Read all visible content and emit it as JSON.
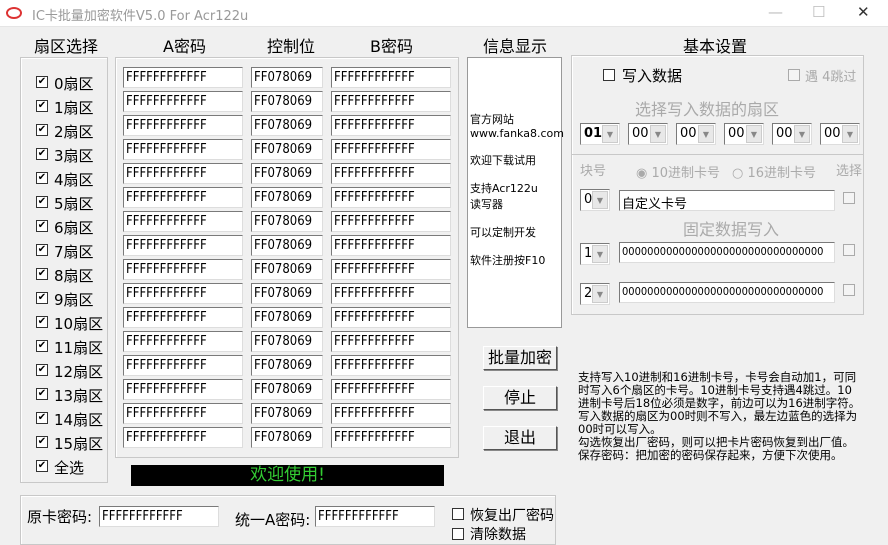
{
  "window": {
    "title": "IC卡批量加密软件V5.0 For Acr122u",
    "min": "—",
    "max": "☐",
    "close": "✕"
  },
  "headers": {
    "sector": "扇区选择",
    "a_key": "A密码",
    "control": "控制位",
    "b_key": "B密码",
    "info": "信息显示",
    "settings": "基本设置"
  },
  "sectors": [
    {
      "label": "0扇区",
      "checked": true,
      "a": "FFFFFFFFFFFF",
      "ctrl": "FF078069",
      "b": "FFFFFFFFFFFF"
    },
    {
      "label": "1扇区",
      "checked": true,
      "a": "FFFFFFFFFFFF",
      "ctrl": "FF078069",
      "b": "FFFFFFFFFFFF"
    },
    {
      "label": "2扇区",
      "checked": true,
      "a": "FFFFFFFFFFFF",
      "ctrl": "FF078069",
      "b": "FFFFFFFFFFFF"
    },
    {
      "label": "3扇区",
      "checked": true,
      "a": "FFFFFFFFFFFF",
      "ctrl": "FF078069",
      "b": "FFFFFFFFFFFF"
    },
    {
      "label": "4扇区",
      "checked": true,
      "a": "FFFFFFFFFFFF",
      "ctrl": "FF078069",
      "b": "FFFFFFFFFFFF"
    },
    {
      "label": "5扇区",
      "checked": true,
      "a": "FFFFFFFFFFFF",
      "ctrl": "FF078069",
      "b": "FFFFFFFFFFFF"
    },
    {
      "label": "6扇区",
      "checked": true,
      "a": "FFFFFFFFFFFF",
      "ctrl": "FF078069",
      "b": "FFFFFFFFFFFF"
    },
    {
      "label": "7扇区",
      "checked": true,
      "a": "FFFFFFFFFFFF",
      "ctrl": "FF078069",
      "b": "FFFFFFFFFFFF"
    },
    {
      "label": "8扇区",
      "checked": true,
      "a": "FFFFFFFFFFFF",
      "ctrl": "FF078069",
      "b": "FFFFFFFFFFFF"
    },
    {
      "label": "9扇区",
      "checked": true,
      "a": "FFFFFFFFFFFF",
      "ctrl": "FF078069",
      "b": "FFFFFFFFFFFF"
    },
    {
      "label": "10扇区",
      "checked": true,
      "a": "FFFFFFFFFFFF",
      "ctrl": "FF078069",
      "b": "FFFFFFFFFFFF"
    },
    {
      "label": "11扇区",
      "checked": true,
      "a": "FFFFFFFFFFFF",
      "ctrl": "FF078069",
      "b": "FFFFFFFFFFFF"
    },
    {
      "label": "12扇区",
      "checked": true,
      "a": "FFFFFFFFFFFF",
      "ctrl": "FF078069",
      "b": "FFFFFFFFFFFF"
    },
    {
      "label": "13扇区",
      "checked": true,
      "a": "FFFFFFFFFFFF",
      "ctrl": "FF078069",
      "b": "FFFFFFFFFFFF"
    },
    {
      "label": "14扇区",
      "checked": true,
      "a": "FFFFFFFFFFFF",
      "ctrl": "FF078069",
      "b": "FFFFFFFFFFFF"
    },
    {
      "label": "15扇区",
      "checked": true,
      "a": "FFFFFFFFFFFF",
      "ctrl": "FF078069",
      "b": "FFFFFFFFFFFF"
    }
  ],
  "select_all": {
    "label": "全选",
    "checked": true
  },
  "status": {
    "text": "欢迎使用!",
    "color": "#33cc33"
  },
  "info_lines": [
    "官方网站",
    "www.fanka8.com",
    "欢迎下载试用",
    "支持Acr122u",
    "读写器",
    "可以定制开发",
    "软件注册按F10"
  ],
  "settings": {
    "write_data": "写入数据",
    "skip4": "遇 4跳过",
    "select_sector": "选择写入数据的扇区",
    "sector_selects": [
      "01",
      "00",
      "00",
      "00",
      "00",
      "00"
    ],
    "block_no": "块号",
    "dec": "10进制卡号",
    "hex": "16进制卡号",
    "choose": "选择",
    "block0": "0",
    "custom": "自定义卡号",
    "fixed": "固定数据写入",
    "block1": "1",
    "data1": "00000000000000000000000000000000",
    "block2": "2",
    "data2": "00000000000000000000000000000000"
  },
  "buttons": {
    "encrypt": "批量加密",
    "stop": "停止",
    "exit": "退出"
  },
  "help": "支持写入10进制和16进制卡号，卡号会自动加1，可同时写入6个扇区的卡号。10进制卡号支持遇4跳过。10进制卡号后18位必须是数字，前边可以为16进制字符。写入数据的扇区为00时则不写入，最左边蓝色的选择为00时可以写入。\n勾选恢复出厂密码，则可以把卡片密码恢复到出厂值。\n保存密码：把加密的密码保存起来，方便下次使用。",
  "bottom": {
    "orig_label": "原卡密码:",
    "orig": "FFFFFFFFFFFF",
    "unified_label": "统一A密码:",
    "unified": "FFFFFFFFFFFF",
    "restore": "恢复出厂密码",
    "clear": "清除数据"
  }
}
